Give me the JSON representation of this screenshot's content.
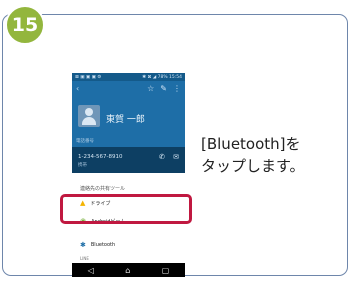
{
  "step": {
    "number": "15"
  },
  "instruction": {
    "line1": "[Bluetooth]を",
    "line2": "タップします。"
  },
  "phone": {
    "status_left": "⊠ ▣ ▣ ▣ ⚙",
    "status_right": "✱ ⊠ ◢ 78% 15:54",
    "header": {
      "back_icon": "back-arrow-icon",
      "contact_name": "東賀 一郎",
      "contact_sub": "電話番号"
    },
    "number_row": {
      "number": "1-234-567-8910",
      "type": "携帯"
    },
    "share_sheet": {
      "title": "連絡先の共有ツール",
      "items": [
        {
          "label": "ドライブ",
          "icon": "drive-icon"
        },
        {
          "label": "Androidビーム",
          "icon": "android-beam-icon"
        },
        {
          "label": "Bluetooth",
          "icon": "bluetooth-icon"
        },
        {
          "label": "LINE",
          "icon": "line-icon"
        }
      ]
    },
    "navbar": {
      "back": "◁",
      "home": "⌂",
      "recent": "▢"
    }
  },
  "colors": {
    "badge": "#93b63d",
    "card_border": "#6e86ab",
    "highlight": "#c01840",
    "header": "#1e6ea7"
  }
}
